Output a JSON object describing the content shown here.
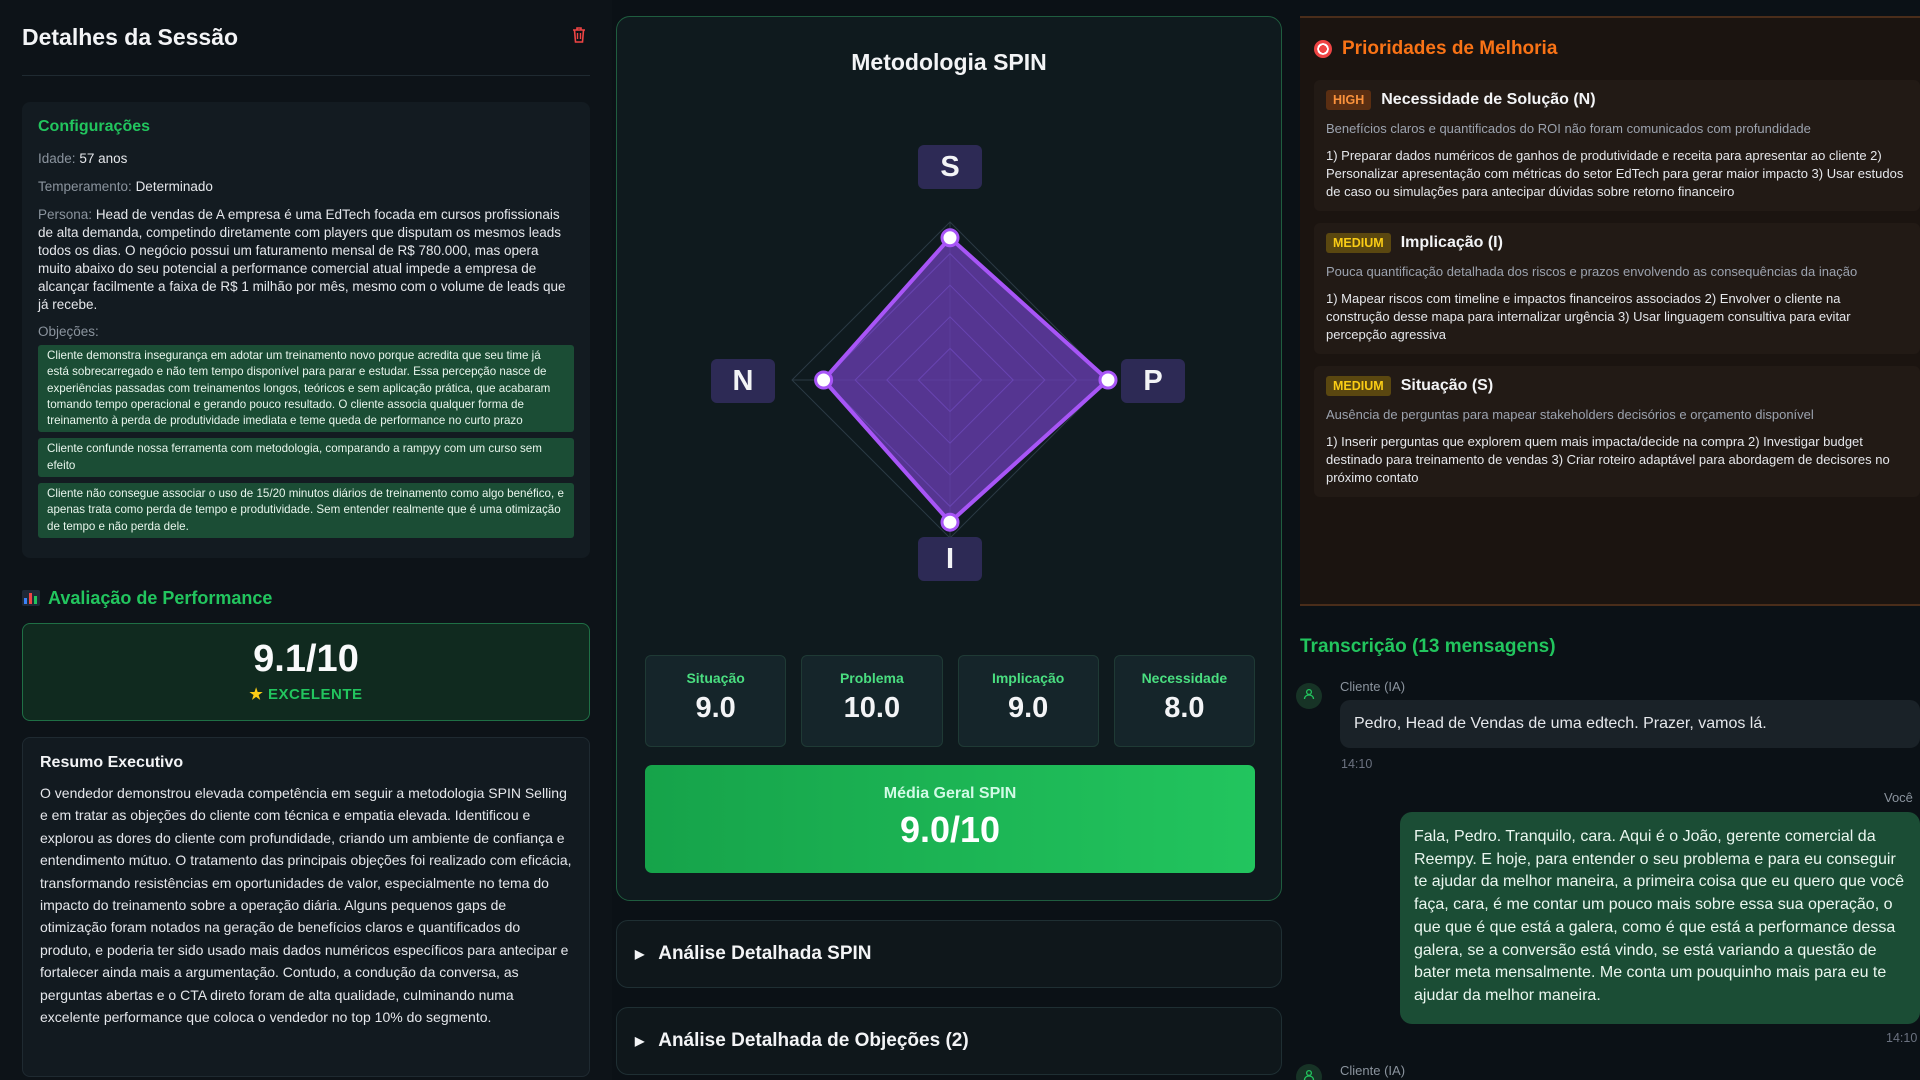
{
  "left": {
    "title": "Detalhes da Sessão",
    "config": {
      "title": "Configurações",
      "age_key": "Idade:",
      "age": "57 anos",
      "temper_key": "Temperamento:",
      "temper": "Determinado",
      "persona_key": "Persona:",
      "persona": "Head de vendas de A empresa é uma EdTech focada em cursos profissionais de alta demanda, competindo diretamente com players que disputam os mesmos leads todos os dias. O negócio possui um faturamento mensal de R$ 780.000, mas opera muito abaixo do seu potencial a performance comercial atual impede a empresa de alcançar facilmente a faixa de R$ 1 milhão por mês, mesmo com o volume de leads que já recebe.",
      "objections_label": "Objeções:",
      "objections": [
        "Cliente demonstra insegurança em adotar um treinamento novo porque acredita que seu time já está sobrecarregado e não tem tempo disponível para parar e estudar. Essa percepção nasce de experiências passadas com treinamentos longos, teóricos e sem aplicação prática, que acabaram tomando tempo operacional e gerando pouco resultado. O cliente associa qualquer forma de treinamento à perda de produtividade imediata e teme queda de performance no curto prazo",
        "Cliente confunde nossa ferramenta com metodologia, comparando a rampyy com um curso sem efeito",
        "Cliente não consegue associar o uso de 15/20 minutos diários de treinamento como algo benéfico, e apenas trata como perda de tempo e produtividade. Sem entender realmente que é uma otimização de tempo e não perda dele."
      ]
    },
    "performance": {
      "title": "Avaliação de Performance",
      "score": "9.1/10",
      "rating": "EXCELENTE"
    },
    "summary": {
      "title": "Resumo Executivo",
      "text": "O vendedor demonstrou elevada competência em seguir a metodologia SPIN Selling e em tratar as objeções do cliente com técnica e empatia elevada. Identificou e explorou as dores do cliente com profundidade, criando um ambiente de confiança e entendimento mútuo. O tratamento das principais objeções foi realizado com eficácia, transformando resistências em oportunidades de valor, especialmente no tema do impacto do treinamento sobre a operação diária. Alguns pequenos gaps de otimização foram notados na geração de benefícios claros e quantificados do produto, e poderia ter sido usado mais dados numéricos específicos para antecipar e fortalecer ainda mais a argumentação. Contudo, a condução da conversa, as perguntas abertas e o CTA direto foram de alta qualidade, culminando numa excelente performance que coloca o vendedor no top 10% do segmento."
    }
  },
  "spin": {
    "title": "Metodologia SPIN",
    "axes": [
      "S",
      "P",
      "I",
      "N"
    ],
    "chart_data": {
      "type": "radar",
      "axes": [
        "S",
        "P",
        "I",
        "N"
      ],
      "values": [
        9.0,
        10.0,
        9.0,
        8.0
      ],
      "max": 10
    },
    "metrics": [
      {
        "name": "Situação",
        "value": "9.0"
      },
      {
        "name": "Problema",
        "value": "10.0"
      },
      {
        "name": "Implicação",
        "value": "9.0"
      },
      {
        "name": "Necessidade",
        "value": "8.0"
      }
    ],
    "avg_label": "Média Geral SPIN",
    "avg_value": "9.0/10",
    "accordion1": "Análise Detalhada SPIN",
    "accordion2": "Análise Detalhada de Objeções (2)",
    "colors": {
      "radar_fill": "#6d3fb8",
      "radar_stroke": "#a855f7",
      "accent": "#22c55e"
    }
  },
  "priorities": {
    "title": "Prioridades de Melhoria",
    "items": [
      {
        "badge": "HIGH",
        "name": "Necessidade de Solução (N)",
        "desc": "Benefícios claros e quantificados do ROI não foram comunicados com profundidade",
        "steps": "1) Preparar dados numéricos de ganhos de produtividade e receita para apresentar ao cliente 2) Personalizar apresentação com métricas do setor EdTech para gerar maior impacto 3) Usar estudos de caso ou simulações para antecipar dúvidas sobre retorno financeiro"
      },
      {
        "badge": "MEDIUM",
        "name": "Implicação (I)",
        "desc": "Pouca quantificação detalhada dos riscos e prazos envolvendo as consequências da inação",
        "steps": "1) Mapear riscos com timeline e impactos financeiros associados 2) Envolver o cliente na construção desse mapa para internalizar urgência 3) Usar linguagem consultiva para evitar percepção agressiva"
      },
      {
        "badge": "MEDIUM",
        "name": "Situação (S)",
        "desc": "Ausência de perguntas para mapear stakeholders decisórios e orçamento disponível",
        "steps": "1) Inserir perguntas que explorem quem mais impacta/decide na compra 2) Investigar budget destinado para treinamento de vendas 3) Criar roteiro adaptável para abordagem de decisores no próximo contato"
      }
    ]
  },
  "transcript": {
    "title": "Transcrição (13 mensagens)",
    "msg1_who": "Cliente (IA)",
    "msg1_text": "Pedro, Head de Vendas de uma edtech. Prazer, vamos lá.",
    "msg1_time": "14:10",
    "msg2_who": "Você",
    "msg2_text": "Fala, Pedro. Tranquilo, cara. Aqui é o João, gerente comercial da Reempy. E hoje, para entender o seu problema e para eu conseguir te ajudar da melhor maneira, a primeira coisa que eu quero que você faça, cara, é me contar um pouco mais sobre essa sua operação, o que que é que está a galera, como é que está a performance dessa galera, se a conversão está vindo, se está variando a questão de bater meta mensalmente. Me conta um pouquinho mais para eu te ajudar da melhor maneira.",
    "msg2_time": "14:10",
    "msg3_who": "Cliente (IA)"
  }
}
